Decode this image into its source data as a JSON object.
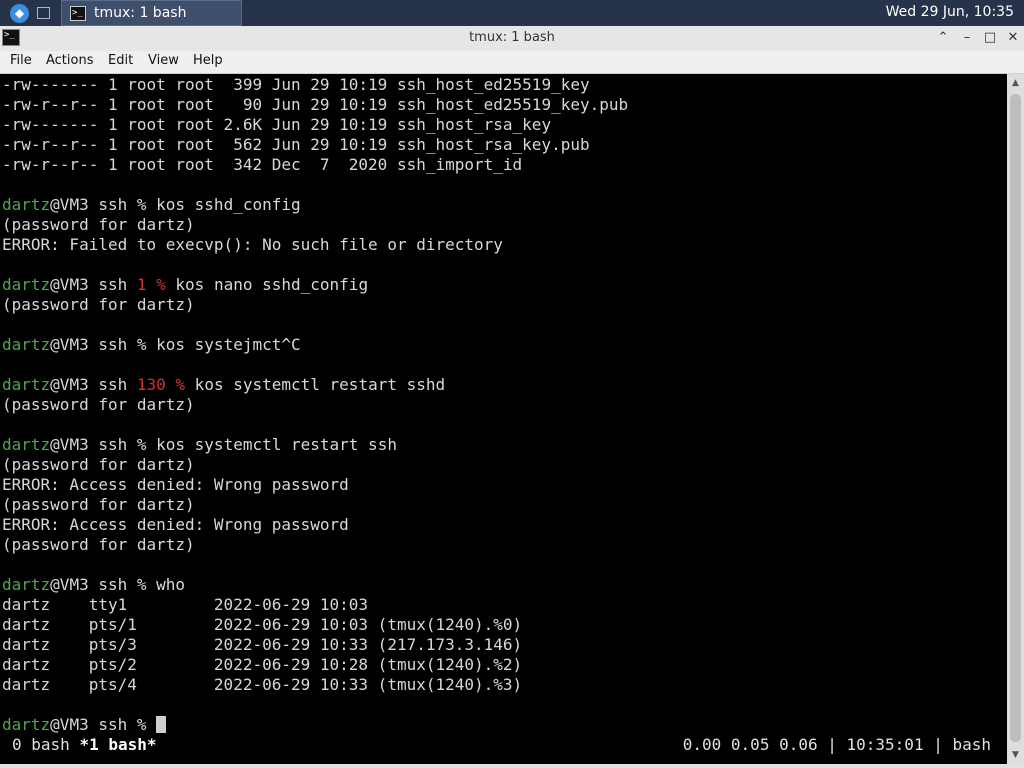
{
  "panel": {
    "task_label": "tmux: 1 bash",
    "clock": "Wed 29 Jun, 10:35"
  },
  "window": {
    "title": "tmux: 1 bash",
    "buttons": {
      "shade": "⌃",
      "minimize": "–",
      "maximize": "□",
      "close": "✕"
    }
  },
  "menu": [
    "File",
    "Actions",
    "Edit",
    "View",
    "Help"
  ],
  "terminal": {
    "lines": [
      [
        "-rw------- 1 root root  399 Jun 29 10:19 ssh_host_ed25519_key"
      ],
      [
        "-rw-r--r-- 1 root root   90 Jun 29 10:19 ssh_host_ed25519_key.pub"
      ],
      [
        "-rw------- 1 root root 2.6K Jun 29 10:19 ssh_host_rsa_key"
      ],
      [
        "-rw-r--r-- 1 root root  562 Jun 29 10:19 ssh_host_rsa_key.pub"
      ],
      [
        "-rw-r--r-- 1 root root  342 Dec  7  2020 ssh_import_id"
      ],
      [
        ""
      ],
      [
        "dartz",
        "@VM3 ssh % kos sshd_config"
      ],
      [
        "(password for dartz)"
      ],
      [
        "ERROR: Failed to execvp(): No such file or directory"
      ],
      [
        ""
      ],
      [
        "dartz",
        "@VM3 ssh ",
        "1 %",
        " kos nano sshd_config"
      ],
      [
        "(password for dartz)"
      ],
      [
        ""
      ],
      [
        "dartz",
        "@VM3 ssh % kos systejmct^C"
      ],
      [
        ""
      ],
      [
        "dartz",
        "@VM3 ssh ",
        "130 %",
        " kos systemctl restart sshd"
      ],
      [
        "(password for dartz)"
      ],
      [
        ""
      ],
      [
        "dartz",
        "@VM3 ssh % kos systemctl restart ssh"
      ],
      [
        "(password for dartz)"
      ],
      [
        "ERROR: Access denied: Wrong password"
      ],
      [
        "(password for dartz)"
      ],
      [
        "ERROR: Access denied: Wrong password"
      ],
      [
        "(password for dartz)"
      ],
      [
        ""
      ],
      [
        "dartz",
        "@VM3 ssh % who"
      ],
      [
        "dartz    tty1         2022-06-29 10:03"
      ],
      [
        "dartz    pts/1        2022-06-29 10:03 (tmux(1240).%0)"
      ],
      [
        "dartz    pts/3        2022-06-29 10:33 (217.173.3.146)"
      ],
      [
        "dartz    pts/2        2022-06-29 10:28 (tmux(1240).%2)"
      ],
      [
        "dartz    pts/4        2022-06-29 10:33 (tmux(1240).%3)"
      ],
      [
        ""
      ],
      [
        "dartz",
        "@VM3 ssh % "
      ]
    ],
    "status_left_inactive": "0 bash ",
    "status_left_active": "*1 bash*",
    "status_right": "0.00 0.05 0.06 | 10:35:01 | bash"
  },
  "colors": {
    "user": "#4ea64e",
    "error_code": "#d03030"
  }
}
